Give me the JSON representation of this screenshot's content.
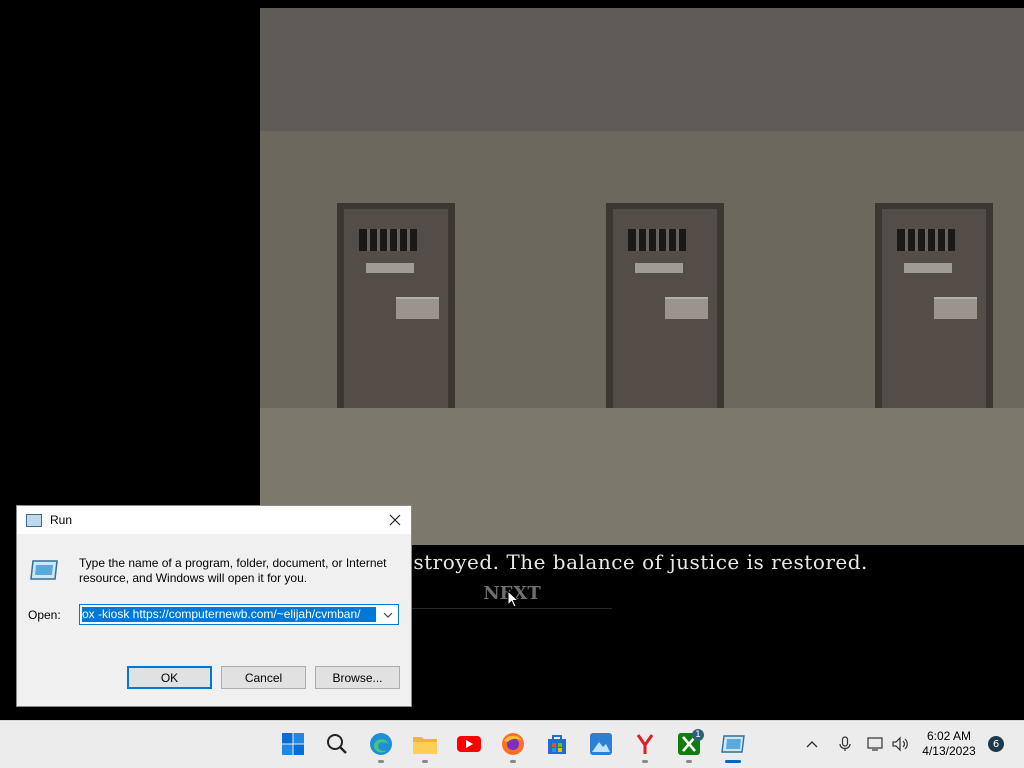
{
  "game": {
    "story_text": "estroyed. The balance of justice is restored.",
    "next_label": "NEXT"
  },
  "run_dialog": {
    "title": "Run",
    "description": "Type the name of a program, folder, document, or Internet resource, and Windows will open it for you.",
    "open_label": "Open:",
    "open_value": "ox -kiosk https://computernewb.com/~elijah/cvmban/",
    "ok_label": "OK",
    "cancel_label": "Cancel",
    "browse_label": "Browse..."
  },
  "taskbar": {
    "apps": [
      {
        "name": "start-icon",
        "color": "#0a6cd6"
      },
      {
        "name": "search-icon",
        "color": "#222222"
      },
      {
        "name": "edge-icon",
        "color": "#1b8fd8"
      },
      {
        "name": "file-explorer-icon",
        "color": "#f0b43a"
      },
      {
        "name": "youtube-icon",
        "color": "#ff0000"
      },
      {
        "name": "firefox-icon",
        "color": "#ff6f21"
      },
      {
        "name": "store-icon",
        "color": "#1c6fd1"
      },
      {
        "name": "photos-icon",
        "color": "#2d7fd3"
      },
      {
        "name": "yandex-icon",
        "color": "#e31b23"
      },
      {
        "name": "xbox-icon",
        "color": "#107c10"
      },
      {
        "name": "run-icon",
        "color": "#3d8fc6"
      }
    ],
    "xbox_badge": "1",
    "time": "6:02 AM",
    "date": "4/13/2023",
    "notification_count": "6"
  }
}
